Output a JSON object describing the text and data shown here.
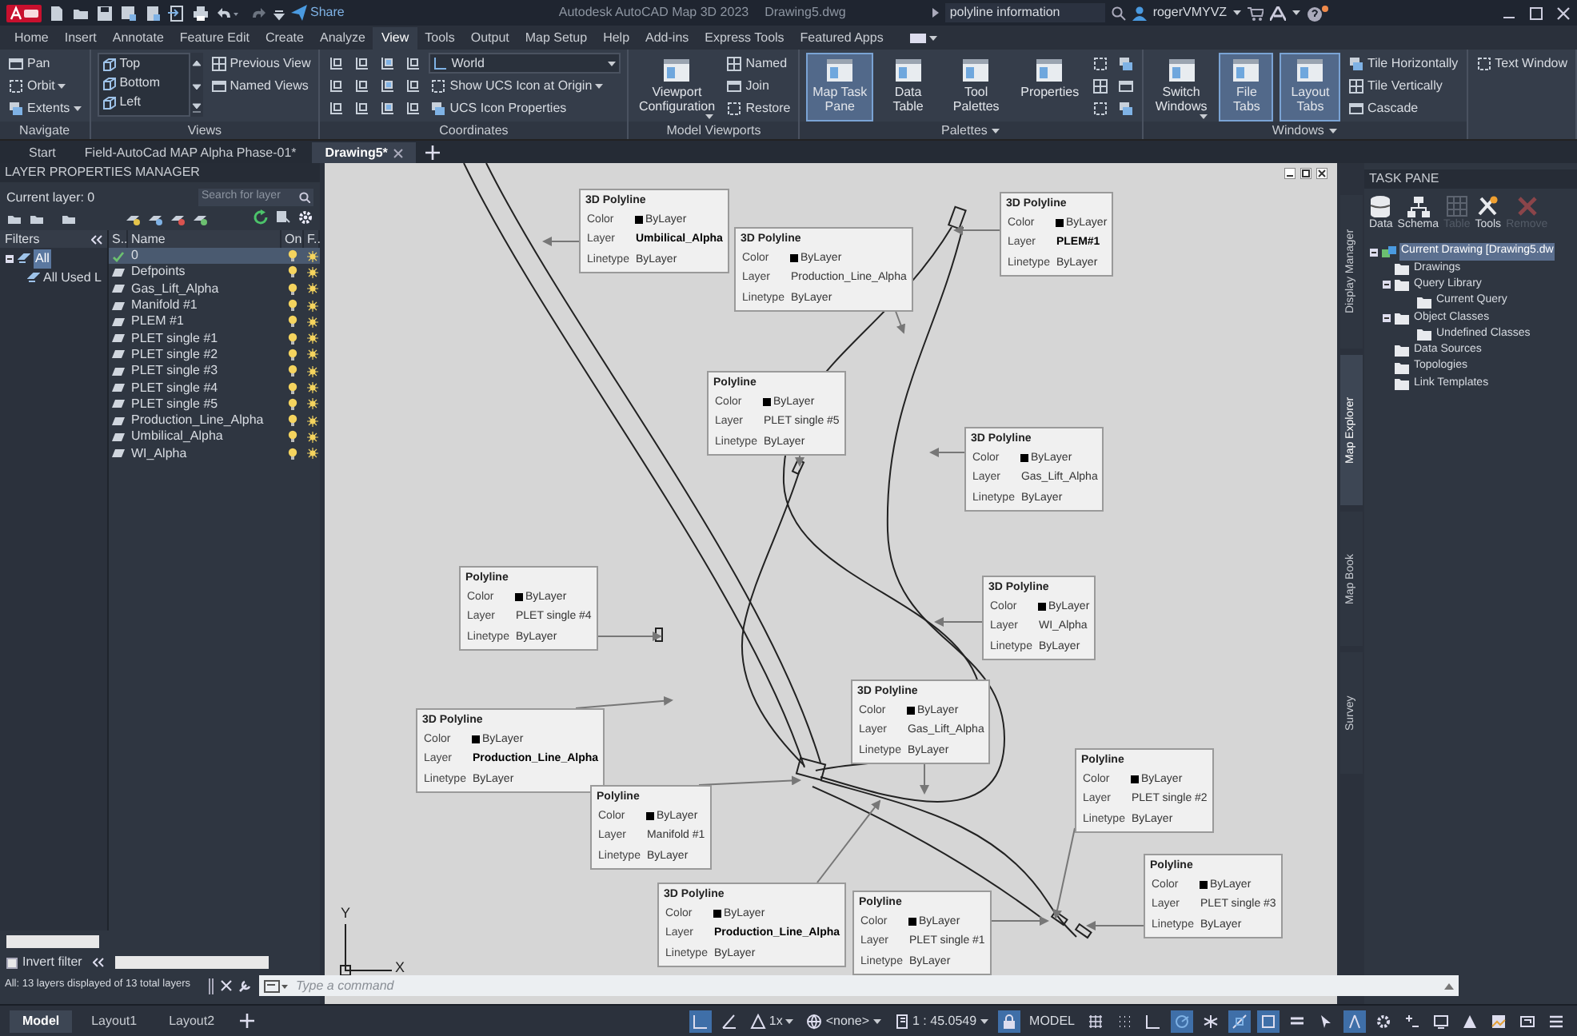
{
  "title_bar": {
    "share": "Share",
    "title": "Autodesk AutoCAD Map 3D 2023",
    "filename": "Drawing5.dwg",
    "search": "polyline information",
    "user": "rogerVMYVZ"
  },
  "ribbon_tabs": [
    {
      "label": "Home",
      "selected": false
    },
    {
      "label": "Insert",
      "selected": false
    },
    {
      "label": "Annotate",
      "selected": false
    },
    {
      "label": "Feature Edit",
      "selected": false
    },
    {
      "label": "Create",
      "selected": false
    },
    {
      "label": "Analyze",
      "selected": false
    },
    {
      "label": "View",
      "selected": true
    },
    {
      "label": "Tools",
      "selected": false
    },
    {
      "label": "Output",
      "selected": false
    },
    {
      "label": "Map Setup",
      "selected": false
    },
    {
      "label": "Help",
      "selected": false
    },
    {
      "label": "Add-ins",
      "selected": false
    },
    {
      "label": "Express Tools",
      "selected": false
    },
    {
      "label": "Featured Apps",
      "selected": false
    }
  ],
  "ribbon_panels": [
    {
      "title": "Navigate",
      "has_menu": false,
      "columns": [
        [
          {
            "kind": "small",
            "label": "Pan",
            "dropdown": false
          },
          {
            "kind": "small",
            "label": "Orbit",
            "dropdown": true
          },
          {
            "kind": "small",
            "label": "Extents",
            "dropdown": true
          }
        ]
      ]
    },
    {
      "title": "Views",
      "has_menu": false,
      "columns": [
        [
          {
            "kind": "list",
            "options": [
              "Top",
              "Bottom",
              "Left"
            ]
          }
        ],
        [
          {
            "kind": "small",
            "label": "Previous View",
            "dropdown": false
          },
          {
            "kind": "small",
            "label": "Named Views",
            "dropdown": false
          }
        ]
      ]
    },
    {
      "title": "Coordinates",
      "has_menu": false,
      "columns": [
        [
          {
            "kind": "icon_grid_wide"
          }
        ],
        [
          {
            "kind": "combo",
            "label": "World"
          },
          {
            "kind": "small",
            "label": "Show UCS Icon at Origin",
            "dropdown": true
          },
          {
            "kind": "small",
            "label": "UCS Icon Properties",
            "dropdown": false
          }
        ]
      ]
    },
    {
      "title": "Model Viewports",
      "has_menu": false,
      "columns": [
        [
          {
            "kind": "large",
            "label": "Viewport Configuration",
            "selected": false,
            "dropdown": true
          }
        ],
        [
          {
            "kind": "small",
            "label": "Named",
            "dropdown": false
          },
          {
            "kind": "small",
            "label": "Join",
            "dropdown": false
          },
          {
            "kind": "small",
            "label": "Restore",
            "dropdown": false
          }
        ]
      ]
    },
    {
      "title": "Palettes",
      "has_menu": true,
      "columns": [
        [
          {
            "kind": "large",
            "label": "Map Task Pane",
            "selected": true,
            "dropdown": false
          }
        ],
        [
          {
            "kind": "large",
            "label": "Data Table",
            "selected": false,
            "dropdown": false
          }
        ],
        [
          {
            "kind": "large",
            "label": "Tool Palettes",
            "selected": false,
            "dropdown": false
          }
        ],
        [
          {
            "kind": "large",
            "label": "Properties",
            "selected": false,
            "dropdown": false
          }
        ],
        [
          {
            "kind": "icon_grid_narrow"
          }
        ]
      ]
    },
    {
      "title": "Windows",
      "has_menu": true,
      "columns": [
        [
          {
            "kind": "large",
            "label": "Switch Windows",
            "selected": false,
            "dropdown": true
          }
        ],
        [
          {
            "kind": "large",
            "label": "File Tabs",
            "selected": true,
            "dropdown": false
          }
        ],
        [
          {
            "kind": "large",
            "label": "Layout Tabs",
            "selected": true,
            "dropdown": false
          }
        ],
        [
          {
            "kind": "small",
            "label": "Tile Horizontally",
            "dropdown": false
          },
          {
            "kind": "small",
            "label": "Tile Vertically",
            "dropdown": false
          },
          {
            "kind": "small",
            "label": "Cascade",
            "dropdown": false
          }
        ]
      ]
    },
    {
      "columns": [
        [
          {
            "kind": "small",
            "label": "Text Window",
            "dropdown": false
          }
        ]
      ]
    }
  ],
  "file_tabs": [
    {
      "label": "Start",
      "selected": false
    },
    {
      "label": "Field-AutoCad MAP Alpha Phase-01*",
      "selected": false
    },
    {
      "label": "Drawing5*",
      "selected": true
    }
  ],
  "layer_manager": {
    "title": "LAYER PROPERTIES MANAGER",
    "current_layer": "Current layer: 0",
    "search_placeholder": "Search for layer",
    "filters_label": "Filters",
    "filters": [
      {
        "label": "All",
        "selected": true,
        "children": [
          {
            "label": "All Used L",
            "selected": false
          }
        ]
      }
    ],
    "columns": [
      "S..",
      "Name",
      "On",
      "F.."
    ],
    "layers": [
      {
        "name": "0",
        "current": true,
        "selected": true
      },
      {
        "name": "Defpoints",
        "current": false,
        "selected": false
      },
      {
        "name": "Gas_Lift_Alpha",
        "current": false,
        "selected": false
      },
      {
        "name": "Manifold #1",
        "current": false,
        "selected": false
      },
      {
        "name": "PLEM #1",
        "current": false,
        "selected": false
      },
      {
        "name": "PLET single #1",
        "current": false,
        "selected": false
      },
      {
        "name": "PLET single #2",
        "current": false,
        "selected": false
      },
      {
        "name": "PLET single #3",
        "current": false,
        "selected": false
      },
      {
        "name": "PLET single #4",
        "current": false,
        "selected": false
      },
      {
        "name": "PLET single #5",
        "current": false,
        "selected": false
      },
      {
        "name": "Production_Line_Alpha",
        "current": false,
        "selected": false
      },
      {
        "name": "Umbilical_Alpha",
        "current": false,
        "selected": false
      },
      {
        "name": "WI_Alpha",
        "current": false,
        "selected": false
      }
    ],
    "invert_filter": {
      "label": "Invert filter",
      "checked": false
    },
    "status": "All: 13 layers displayed of 13 total layers"
  },
  "callouts": [
    {
      "type": "3D Polyline",
      "bold_layer": true,
      "fields": [
        {
          "kind": "color",
          "label": "Color",
          "value": "ByLayer"
        },
        {
          "kind": "text",
          "label": "Layer",
          "value": "Umbilical_Alpha"
        },
        {
          "kind": "text",
          "label": "Linetype",
          "value": "ByLayer"
        }
      ]
    },
    {
      "type": "3D Polyline",
      "bold_layer": false,
      "fields": [
        {
          "kind": "color",
          "label": "Color",
          "value": "ByLayer"
        },
        {
          "kind": "text",
          "label": "Layer",
          "value": "Production_Line_Alpha"
        },
        {
          "kind": "text",
          "label": "Linetype",
          "value": "ByLayer"
        }
      ]
    },
    {
      "type": "3D Polyline",
      "bold_layer": true,
      "fields": [
        {
          "kind": "color",
          "label": "Color",
          "value": "ByLayer"
        },
        {
          "kind": "text",
          "label": "Layer",
          "value": "PLEM#1"
        },
        {
          "kind": "text",
          "label": "Linetype",
          "value": "ByLayer"
        }
      ]
    },
    {
      "type": "Polyline",
      "bold_layer": false,
      "fields": [
        {
          "kind": "color",
          "label": "Color",
          "value": "ByLayer"
        },
        {
          "kind": "text",
          "label": "Layer",
          "value": "PLET single #5"
        },
        {
          "kind": "text",
          "label": "Linetype",
          "value": "ByLayer"
        }
      ]
    },
    {
      "type": "3D Polyline",
      "bold_layer": false,
      "fields": [
        {
          "kind": "color",
          "label": "Color",
          "value": "ByLayer"
        },
        {
          "kind": "text",
          "label": "Layer",
          "value": "Gas_Lift_Alpha"
        },
        {
          "kind": "text",
          "label": "Linetype",
          "value": "ByLayer"
        }
      ]
    },
    {
      "type": "Polyline",
      "bold_layer": false,
      "fields": [
        {
          "kind": "color",
          "label": "Color",
          "value": "ByLayer"
        },
        {
          "kind": "text",
          "label": "Layer",
          "value": "PLET single #4"
        },
        {
          "kind": "text",
          "label": "Linetype",
          "value": "ByLayer"
        }
      ]
    },
    {
      "type": "3D Polyline",
      "bold_layer": false,
      "fields": [
        {
          "kind": "color",
          "label": "Color",
          "value": "ByLayer"
        },
        {
          "kind": "text",
          "label": "Layer",
          "value": "WI_Alpha"
        },
        {
          "kind": "text",
          "label": "Linetype",
          "value": "ByLayer"
        }
      ]
    },
    {
      "type": "3D Polyline",
      "bold_layer": true,
      "fields": [
        {
          "kind": "color",
          "label": "Color",
          "value": "ByLayer"
        },
        {
          "kind": "text",
          "label": "Layer",
          "value": "Production_Line_Alpha"
        },
        {
          "kind": "text",
          "label": "Linetype",
          "value": "ByLayer"
        }
      ]
    },
    {
      "type": "3D Polyline",
      "bold_layer": false,
      "fields": [
        {
          "kind": "color",
          "label": "Color",
          "value": "ByLayer"
        },
        {
          "kind": "text",
          "label": "Layer",
          "value": "Gas_Lift_Alpha"
        },
        {
          "kind": "text",
          "label": "Linetype",
          "value": "ByLayer"
        }
      ]
    },
    {
      "type": "Polyline",
      "bold_layer": false,
      "fields": [
        {
          "kind": "color",
          "label": "Color",
          "value": "ByLayer"
        },
        {
          "kind": "text",
          "label": "Layer",
          "value": "PLET single #2"
        },
        {
          "kind": "text",
          "label": "Linetype",
          "value": "ByLayer"
        }
      ]
    },
    {
      "type": "Polyline",
      "bold_layer": false,
      "fields": [
        {
          "kind": "color",
          "label": "Color",
          "value": "ByLayer"
        },
        {
          "kind": "text",
          "label": "Layer",
          "value": "Manifold #1"
        },
        {
          "kind": "text",
          "label": "Linetype",
          "value": "ByLayer"
        }
      ]
    },
    {
      "type": "3D Polyline",
      "bold_layer": true,
      "fields": [
        {
          "kind": "color",
          "label": "Color",
          "value": "ByLayer"
        },
        {
          "kind": "text",
          "label": "Layer",
          "value": "Production_Line_Alpha"
        },
        {
          "kind": "text",
          "label": "Linetype",
          "value": "ByLayer"
        }
      ]
    },
    {
      "type": "Polyline",
      "bold_layer": false,
      "fields": [
        {
          "kind": "color",
          "label": "Color",
          "value": "ByLayer"
        },
        {
          "kind": "text",
          "label": "Layer",
          "value": "PLET single #1"
        },
        {
          "kind": "text",
          "label": "Linetype",
          "value": "ByLayer"
        }
      ]
    },
    {
      "type": "Polyline",
      "bold_layer": false,
      "fields": [
        {
          "kind": "color",
          "label": "Color",
          "value": "ByLayer"
        },
        {
          "kind": "text",
          "label": "Layer",
          "value": "PLET single #3"
        },
        {
          "kind": "text",
          "label": "Linetype",
          "value": "ByLayer"
        }
      ]
    }
  ],
  "ucs": {
    "y": "Y",
    "x": "X"
  },
  "command_line": {
    "placeholder": "Type a command"
  },
  "task_pane": {
    "title": "TASK PANE",
    "side_tabs": [
      {
        "label": "Display Manager",
        "selected": false
      },
      {
        "label": "Map Explorer",
        "selected": true
      },
      {
        "label": "Map Book",
        "selected": false
      },
      {
        "label": "Survey",
        "selected": false
      }
    ],
    "tools": [
      {
        "label": "Data",
        "disabled": false
      },
      {
        "label": "Schema",
        "disabled": false
      },
      {
        "label": "Table",
        "disabled": true
      },
      {
        "label": "Tools",
        "disabled": false
      },
      {
        "label": "Remove",
        "disabled": true
      }
    ],
    "tree": [
      {
        "label": "Current Drawing [Drawing5.dw",
        "selected": true,
        "expanded": true,
        "children": [
          {
            "label": "Drawings",
            "selected": false
          },
          {
            "label": "Query Library",
            "selected": false,
            "expanded": true,
            "children": [
              {
                "label": "Current Query",
                "selected": false
              }
            ]
          },
          {
            "label": "Object Classes",
            "selected": false,
            "expanded": true,
            "children": [
              {
                "label": "Undefined Classes",
                "selected": false
              }
            ]
          },
          {
            "label": "Data Sources",
            "selected": false
          },
          {
            "label": "Topologies",
            "selected": false
          },
          {
            "label": "Link Templates",
            "selected": false
          }
        ]
      }
    ]
  },
  "layout_tabs": [
    {
      "label": "Model",
      "selected": true
    },
    {
      "label": "Layout1",
      "selected": false
    },
    {
      "label": "Layout2",
      "selected": false
    }
  ],
  "status_items": [
    "1x",
    "<none>",
    "1 : 45.0549",
    "MODEL"
  ]
}
